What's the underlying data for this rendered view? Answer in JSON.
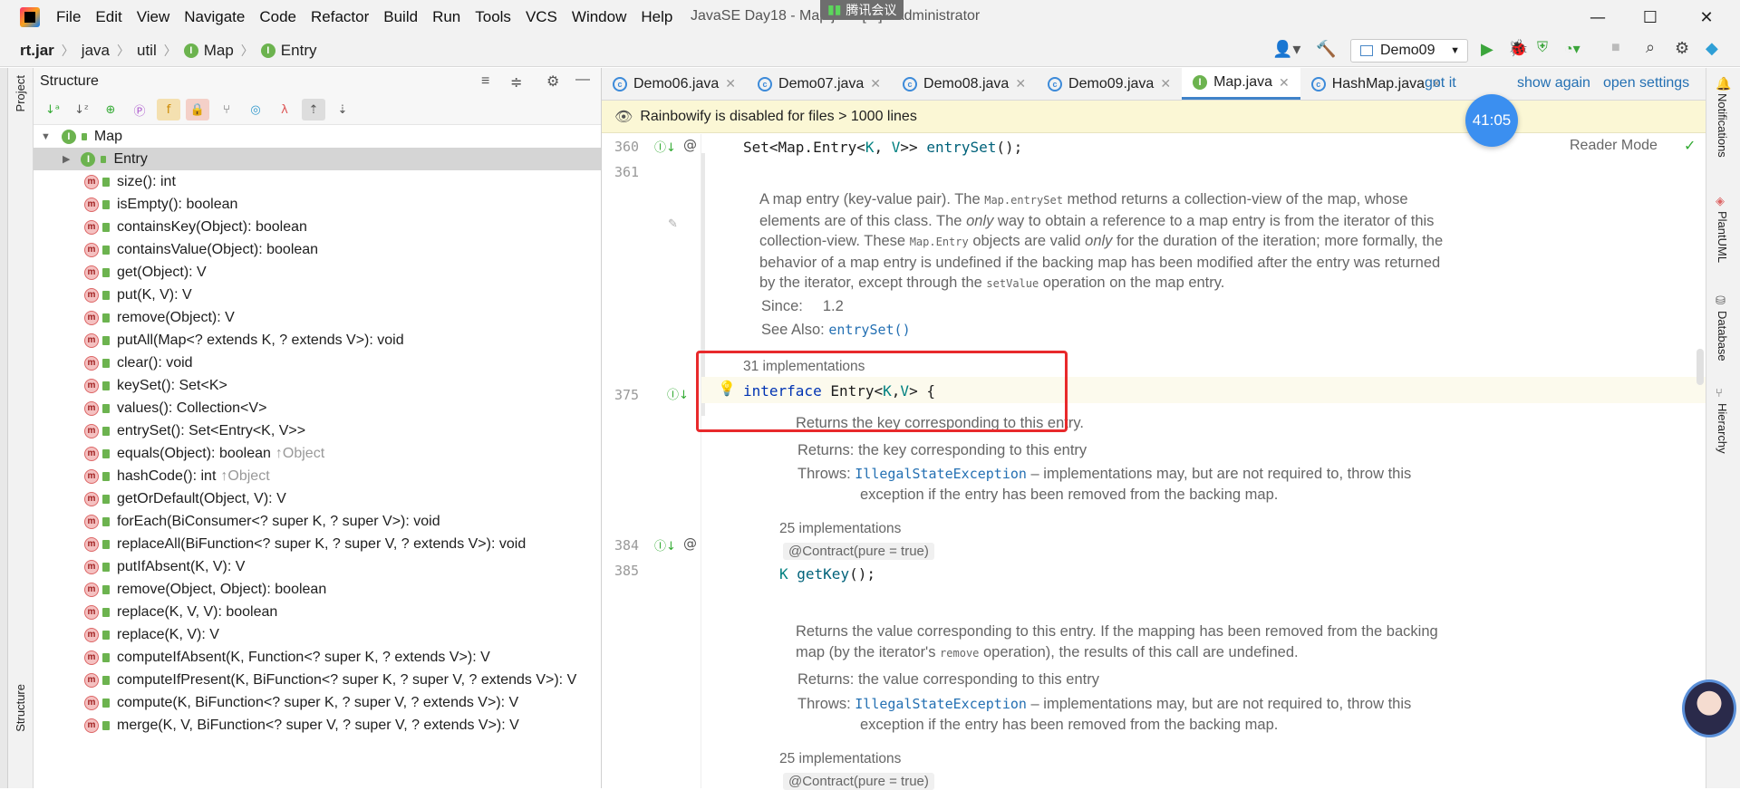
{
  "menu": [
    "File",
    "Edit",
    "View",
    "Navigate",
    "Code",
    "Refactor",
    "Build",
    "Run",
    "Tools",
    "VCS",
    "Window",
    "Help"
  ],
  "window_title": "JavaSE Day18 - Map.java [...] - Administrator",
  "meeting_badge": "腾讯会议",
  "breadcrumb": [
    "rt.jar",
    "java",
    "util",
    "Map",
    "Entry"
  ],
  "run_config": "Demo09",
  "structure": {
    "title": "Structure",
    "root": "Map",
    "selected": "Entry",
    "members": [
      {
        "name": "size(): int",
        "inherited": ""
      },
      {
        "name": "isEmpty(): boolean",
        "inherited": ""
      },
      {
        "name": "containsKey(Object): boolean",
        "inherited": ""
      },
      {
        "name": "containsValue(Object): boolean",
        "inherited": ""
      },
      {
        "name": "get(Object): V",
        "inherited": ""
      },
      {
        "name": "put(K, V): V",
        "inherited": ""
      },
      {
        "name": "remove(Object): V",
        "inherited": ""
      },
      {
        "name": "putAll(Map<? extends K, ? extends V>): void",
        "inherited": ""
      },
      {
        "name": "clear(): void",
        "inherited": ""
      },
      {
        "name": "keySet(): Set<K>",
        "inherited": ""
      },
      {
        "name": "values(): Collection<V>",
        "inherited": ""
      },
      {
        "name": "entrySet(): Set<Entry<K, V>>",
        "inherited": ""
      },
      {
        "name": "equals(Object): boolean",
        "inherited": "↑Object"
      },
      {
        "name": "hashCode(): int",
        "inherited": "↑Object"
      },
      {
        "name": "getOrDefault(Object, V): V",
        "inherited": ""
      },
      {
        "name": "forEach(BiConsumer<? super K, ? super V>): void",
        "inherited": ""
      },
      {
        "name": "replaceAll(BiFunction<? super K, ? super V, ? extends V>): void",
        "inherited": ""
      },
      {
        "name": "putIfAbsent(K, V): V",
        "inherited": ""
      },
      {
        "name": "remove(Object, Object): boolean",
        "inherited": ""
      },
      {
        "name": "replace(K, V, V): boolean",
        "inherited": ""
      },
      {
        "name": "replace(K, V): V",
        "inherited": ""
      },
      {
        "name": "computeIfAbsent(K, Function<? super K, ? extends V>): V",
        "inherited": ""
      },
      {
        "name": "computeIfPresent(K, BiFunction<? super K, ? super V, ? extends V>): V",
        "inherited": ""
      },
      {
        "name": "compute(K, BiFunction<? super K, ? super V, ? extends V>): V",
        "inherited": ""
      },
      {
        "name": "merge(K, V, BiFunction<? super V, ? super V, ? extends V>): V",
        "inherited": ""
      }
    ]
  },
  "left_tool_labels": {
    "project": "Project",
    "structure": "Structure"
  },
  "tabs": [
    {
      "label": "Demo06.java",
      "active": false
    },
    {
      "label": "Demo07.java",
      "active": false
    },
    {
      "label": "Demo08.java",
      "active": false
    },
    {
      "label": "Demo09.java",
      "active": false
    },
    {
      "label": "Map.java",
      "active": true
    },
    {
      "label": "HashMap.java",
      "active": false
    }
  ],
  "banner": {
    "message": "Rainbowify is disabled for files > 1000 lines",
    "got_it": "got it",
    "dont_show": "show again",
    "open_settings": "open settings"
  },
  "timer": "41:05",
  "reader_mode": "Reader Mode",
  "editor": {
    "line_360": "360",
    "line_361": "361",
    "line_375": "375",
    "line_384": "384",
    "line_385": "385",
    "code_360_a": "Set<Map.Entry<",
    "code_360_k": "K",
    "code_360_b": ", ",
    "code_360_v": "V",
    "code_360_c": ">> ",
    "code_360_fn": "entrySet",
    "code_360_d": "();",
    "doc1_p1": "A map entry (key-value pair). The ",
    "doc1_code1": "Map.entrySet",
    "doc1_p2": " method returns a collection-view of the map, whose elements are of this class. The ",
    "doc1_em1": "only",
    "doc1_p3": " way to obtain a reference to a map entry is from the iterator of this collection-view. These ",
    "doc1_code2": "Map.Entry",
    "doc1_p4": " objects are valid ",
    "doc1_em2": "only",
    "doc1_p5": " for the duration of the iteration; more formally, the behavior of a map entry is undefined if the backing map has been modified after the entry was returned by the iterator, except through the ",
    "doc1_code3": "setValue",
    "doc1_p6": " operation on the map entry.",
    "since_label": "Since:",
    "since_value": "1.2",
    "see_also_label": "See Also:",
    "see_also_value": "entrySet()",
    "impl_31": "31 implementations",
    "code_375_kw": "interface",
    "code_375_name": " Entry<",
    "code_375_k": "K",
    "code_375_comma": ",",
    "code_375_v": "V",
    "code_375_end": "> {",
    "doc2_text": "Returns the key corresponding to this entry.",
    "returns_label": "Returns:",
    "doc2_returns": "the key corresponding to this entry",
    "throws_label": "Throws:",
    "exception": "IllegalStateException",
    "throws_text": " – implementations may, but are not required to, throw this exception if the entry has been removed from the backing map.",
    "impl_25": "25 implementations",
    "contract": "@Contract(pure = true)",
    "code_384_k": "K",
    "code_384_fn": " getKey",
    "code_384_end": "();",
    "doc3_p1": "Returns the value corresponding to this entry. If the mapping has been removed from the backing map (by the iterator's ",
    "doc3_code": "remove",
    "doc3_p2": " operation), the results of this call are undefined.",
    "doc3_returns": "the value corresponding to this entry"
  },
  "right_tool_labels": {
    "notifications": "Notifications",
    "plantuml": "PlantUML",
    "database": "Database",
    "hierarchy": "Hierarchy"
  }
}
